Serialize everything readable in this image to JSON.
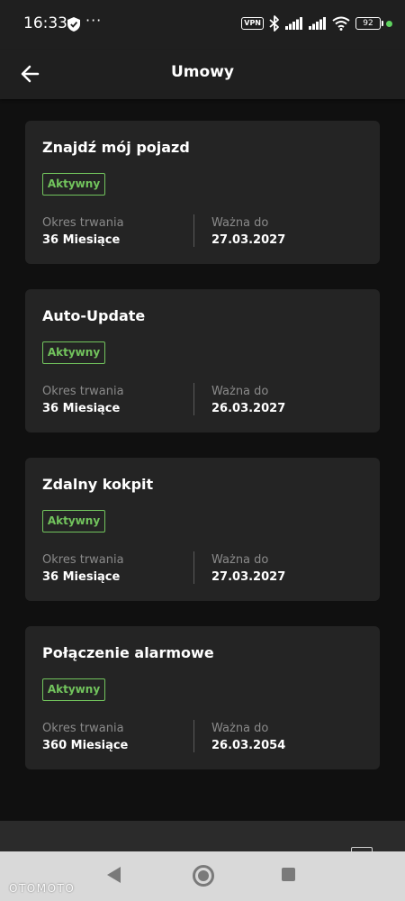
{
  "status_bar": {
    "time": "16:33",
    "dots": "···",
    "vpn": "VPN",
    "battery": "92"
  },
  "header": {
    "title": "Umowy"
  },
  "contracts": [
    {
      "title": "Znajdź mój pojazd",
      "status": "Aktywny",
      "duration_label": "Okres trwania",
      "duration_value": "36 Miesiące",
      "valid_label": "Ważna do",
      "valid_value": "27.03.2027"
    },
    {
      "title": "Auto-Update",
      "status": "Aktywny",
      "duration_label": "Okres trwania",
      "duration_value": "36 Miesiące",
      "valid_label": "Ważna do",
      "valid_value": "26.03.2027"
    },
    {
      "title": "Zdalny kokpit",
      "status": "Aktywny",
      "duration_label": "Okres trwania",
      "duration_value": "36 Miesiące",
      "valid_label": "Ważna do",
      "valid_value": "27.03.2027"
    },
    {
      "title": "Połączenie alarmowe",
      "status": "Aktywny",
      "duration_label": "Okres trwania",
      "duration_value": "360 Miesiące",
      "valid_label": "Ważna do",
      "valid_value": "26.03.2054"
    }
  ],
  "watermark": "OTOMOTO",
  "colors": {
    "background": "#101010",
    "card": "#242424",
    "active_green": "#72c45d",
    "label_gray": "#8a8a8a"
  }
}
